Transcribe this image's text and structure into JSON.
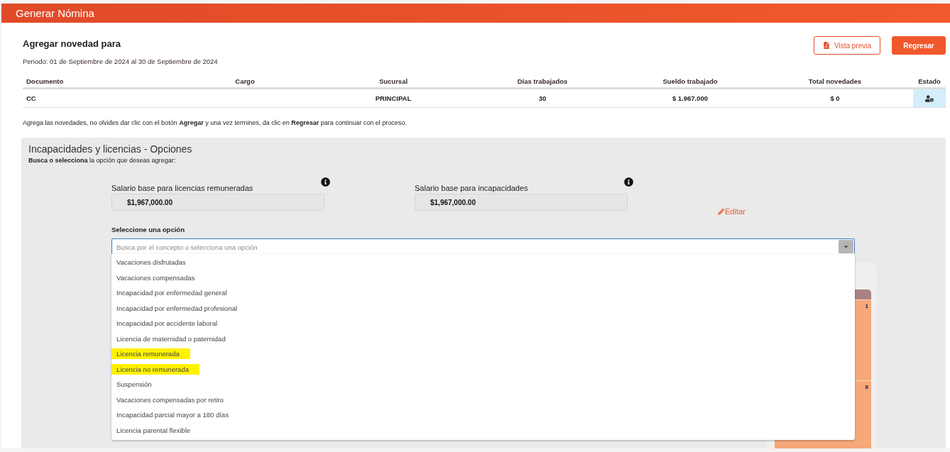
{
  "header": {
    "title": "Generar Nómina"
  },
  "page": {
    "title": "Agregar novedad para",
    "period": "Periodo: 01 de Septiembre de 2024 al 30 de Septiembre de 2024"
  },
  "buttons": [
    {
      "kind": "outline",
      "label": "Vista previa"
    },
    {
      "kind": "primary",
      "label": "Regresar"
    }
  ],
  "table": {
    "columns": [
      "Documento",
      "Cargo",
      "Sucursal",
      "Días trabajados",
      "Sueldo trabajado",
      "Total novedades",
      "Estado"
    ],
    "rows": [
      {
        "cells": [
          "CC",
          "",
          "PRINCIPAL",
          "30",
          "$ 1.967.000",
          "$ 0"
        ]
      }
    ]
  },
  "instructions": "Agrega las novedades, no olvides dar clic con el botón **Agregar** y una vez termines, da clic en **Regresar** para continuar con el proceso.",
  "options_panel": {
    "title": "Incapacidades y licencias - Opciones",
    "subtitle": "**Busca o selecciona** la opción que deseas agregar:",
    "fields": [
      {
        "label": "Salario base para licencias remuneradas",
        "value": "$1,967,000.00"
      },
      {
        "label": "Salario base para incapacidades",
        "value": "$1,967,000.00"
      }
    ],
    "edit_link": "Editar",
    "select_label": "Seleccione una opción",
    "select_placeholder": "Busca por el concepto o selecciona una opción",
    "options": [
      {
        "label": "Vacaciones disfrutadas",
        "highlighted": false
      },
      {
        "label": "Vacaciones compensadas",
        "highlighted": false
      },
      {
        "label": "Incapacidad por enfermedad general",
        "highlighted": false
      },
      {
        "label": "Incapacidad por enfermedad profesional",
        "highlighted": false
      },
      {
        "label": "Incapacidad por accidente laboral",
        "highlighted": false
      },
      {
        "label": "Licencia de maternidad o paternidad",
        "highlighted": false
      },
      {
        "label": "Licencia remunerada",
        "highlighted": true
      },
      {
        "label": "Licencia no remunerada",
        "highlighted": true
      },
      {
        "label": "Suspensión",
        "highlighted": false
      },
      {
        "label": "Vacaciones compensadas por retiro",
        "highlighted": false
      },
      {
        "label": "Incapacidad parcial mayor a 180 días",
        "highlighted": false
      },
      {
        "label": "Licencia parental flexible",
        "highlighted": false
      }
    ],
    "calendar_cells": [
      "1",
      "8"
    ]
  }
}
